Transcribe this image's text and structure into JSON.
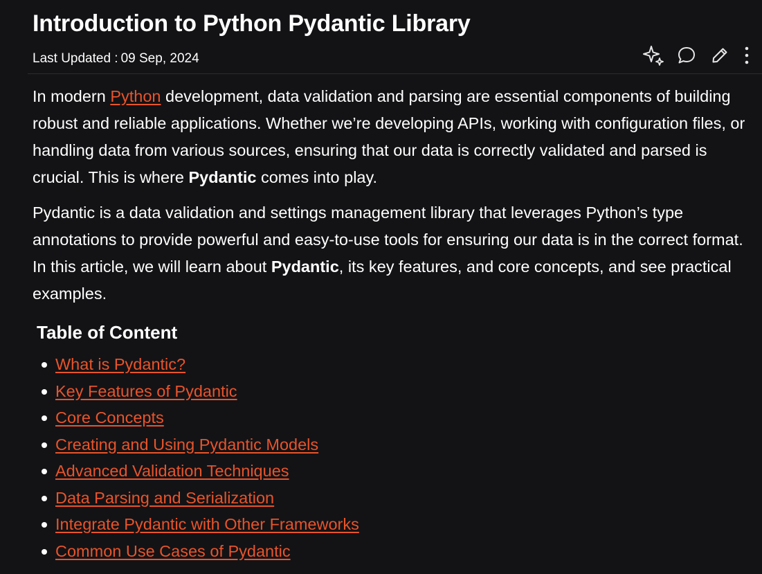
{
  "article": {
    "title": "Introduction to Python Pydantic Library",
    "updated_label": "Last Updated :",
    "updated_date": "09 Sep, 2024"
  },
  "actions": [
    {
      "name": "ai-sparkle-icon"
    },
    {
      "name": "comment-icon"
    },
    {
      "name": "edit-icon"
    },
    {
      "name": "more-options-icon"
    }
  ],
  "intro": {
    "p1_before_link": "In modern ",
    "p1_link": "Python",
    "p1_after_link": " development, data validation and parsing are essential components of building robust and reliable applications. Whether we’re developing APIs, working with configuration files, or handling data from various sources, ensuring that our data is correctly validated and parsed is crucial. This is where ",
    "p1_bold": "Pydantic",
    "p1_end": " comes into play.",
    "p2_start": "Pydantic is a data validation and settings management library that leverages Python’s type annotations to provide powerful and easy-to-use tools for ensuring our data is in the correct format. In this article, we will learn about ",
    "p2_bold": "Pydantic",
    "p2_end": ", its key features, and core concepts, and see practical examples."
  },
  "toc": {
    "title": "Table of Content",
    "items": [
      "What is Pydantic?",
      "Key Features of Pydantic",
      "Core Concepts",
      "Creating and Using Pydantic Models",
      "Advanced Validation Techniques",
      "Data Parsing and Serialization",
      "Integrate Pydantic with Other Frameworks",
      "Common Use Cases of Pydantic"
    ]
  },
  "colors": {
    "background": "#131316",
    "text": "#ffffff",
    "link": "#e8542a"
  }
}
